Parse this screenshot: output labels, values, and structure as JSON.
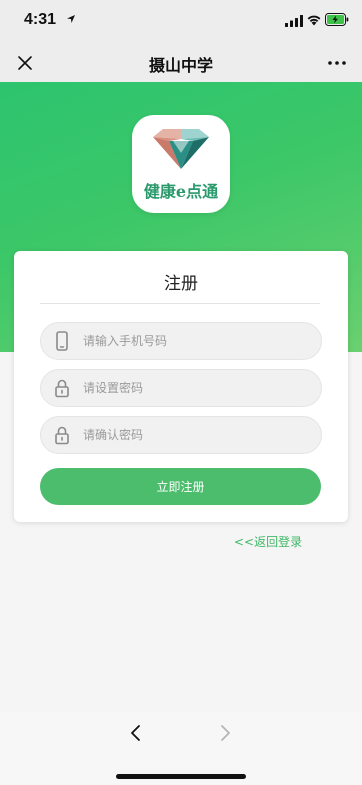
{
  "status_bar": {
    "time": "4:31",
    "icons": [
      "location-arrow-icon",
      "cellular-signal-icon",
      "wifi-icon",
      "battery-charging-icon"
    ]
  },
  "nav": {
    "title": "摄山中学",
    "left_icon": "close-icon",
    "right_icon": "more-icon"
  },
  "logo": {
    "text": "健康e点通",
    "icon": "diamond-icon"
  },
  "form": {
    "title": "注册",
    "phone_placeholder": "请输入手机号码",
    "password_placeholder": "请设置密码",
    "confirm_placeholder": "请确认密码",
    "submit_label": "立即注册",
    "back_login_label": "<<返回登录"
  },
  "bottom_nav": {
    "back_icon": "chevron-left-icon",
    "forward_icon": "chevron-right-icon"
  },
  "colors": {
    "accent": "#4cbd6d",
    "hero_start": "#2dc46f",
    "hero_end": "#6ad070",
    "link": "#3fb866"
  }
}
